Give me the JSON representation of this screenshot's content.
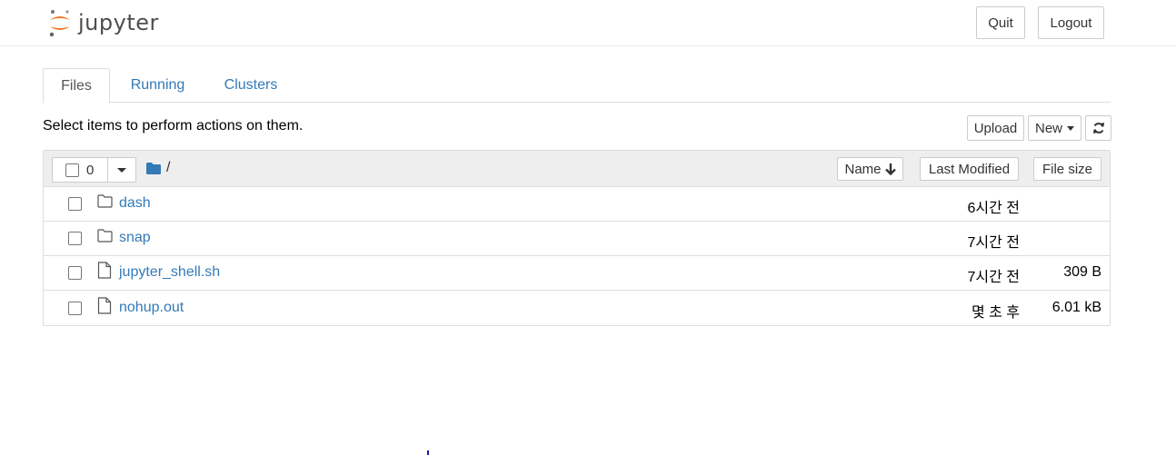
{
  "header": {
    "logo_text": "jupyter",
    "quit_label": "Quit",
    "logout_label": "Logout"
  },
  "tabs": [
    {
      "label": "Files",
      "active": true
    },
    {
      "label": "Running",
      "active": false
    },
    {
      "label": "Clusters",
      "active": false
    }
  ],
  "toolbar": {
    "hint": "Select items to perform actions on them.",
    "upload_label": "Upload",
    "new_label": "New"
  },
  "list_header": {
    "selected_count": "0",
    "breadcrumb": "/",
    "sort_name_label": "Name",
    "sort_modified_label": "Last Modified",
    "sort_size_label": "File size"
  },
  "files": [
    {
      "name": "dash",
      "type": "folder",
      "modified": "6시간 전",
      "size": ""
    },
    {
      "name": "snap",
      "type": "folder",
      "modified": "7시간 전",
      "size": ""
    },
    {
      "name": "jupyter_shell.sh",
      "type": "file",
      "modified": "7시간 전",
      "size": "309 B"
    },
    {
      "name": "nohup.out",
      "type": "file",
      "modified": "몇 초 후",
      "size": "6.01 kB"
    }
  ],
  "colors": {
    "link": "#337ab7",
    "logo_orange": "#f37626",
    "folder_blue": "#337ab7"
  }
}
